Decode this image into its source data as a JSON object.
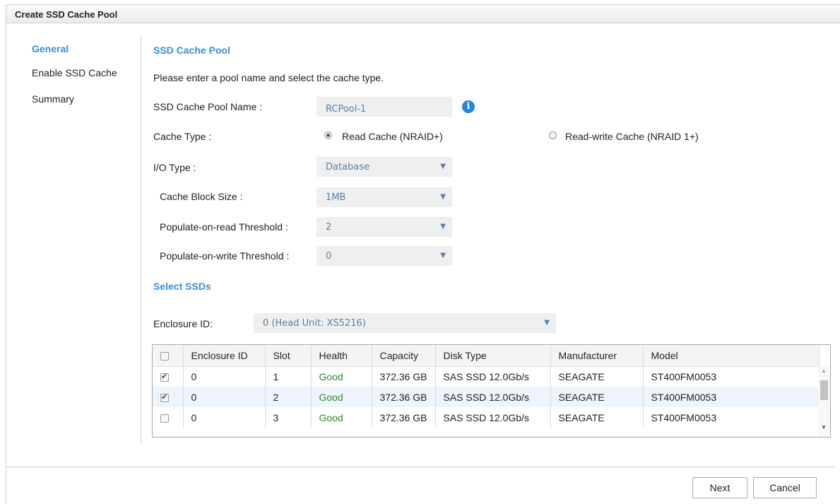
{
  "dialog": {
    "title": "Create SSD Cache Pool"
  },
  "nav": {
    "items": [
      "General",
      "Enable SSD Cache",
      "Summary"
    ]
  },
  "pool": {
    "section_title": "SSD Cache Pool",
    "instruction": "Please enter a pool name and select the cache type.",
    "name_label": "SSD Cache Pool Name :",
    "name_value": "RCPool-1",
    "info_icon": "info-icon",
    "cache_type_label": "Cache Type :",
    "cache_type_options": [
      "Read Cache (NRAID+)",
      "Read-write Cache (NRAID 1+)"
    ],
    "cache_type_selected": "Read Cache (NRAID+)",
    "io_type_label": "I/O Type :",
    "io_type_value": "Database",
    "block_size_label": "Cache Block Size :",
    "block_size_value": "1MB",
    "read_threshold_label": "Populate-on-read Threshold :",
    "read_threshold_value": "2",
    "write_threshold_label": "Populate-on-write Threshold :",
    "write_threshold_value": "0"
  },
  "ssds": {
    "section_title": "Select SSDs",
    "enclosure_label": "Enclosure ID:",
    "enclosure_value": "0 (Head Unit: XS5216)",
    "columns": [
      "Enclosure ID",
      "Slot",
      "Health",
      "Capacity",
      "Disk Type",
      "Manufacturer",
      "Model"
    ],
    "rows": [
      {
        "checked": true,
        "enclosure": "0",
        "slot": "1",
        "health": "Good",
        "capacity": "372.36 GB",
        "disk_type": "SAS SSD 12.0Gb/s",
        "manufacturer": "SEAGATE",
        "model": "ST400FM0053"
      },
      {
        "checked": true,
        "enclosure": "0",
        "slot": "2",
        "health": "Good",
        "capacity": "372.36 GB",
        "disk_type": "SAS SSD 12.0Gb/s",
        "manufacturer": "SEAGATE",
        "model": "ST400FM0053"
      },
      {
        "checked": false,
        "enclosure": "0",
        "slot": "3",
        "health": "Good",
        "capacity": "372.36 GB",
        "disk_type": "SAS SSD 12.0Gb/s",
        "manufacturer": "SEAGATE",
        "model": "ST400FM0053"
      }
    ]
  },
  "buttons": {
    "next": "Next",
    "cancel": "Cancel"
  },
  "colors": {
    "accent": "#3a8fd6",
    "good": "#2e8b2e",
    "info": "#1e88e5",
    "row_alt": "#eef4fb"
  }
}
